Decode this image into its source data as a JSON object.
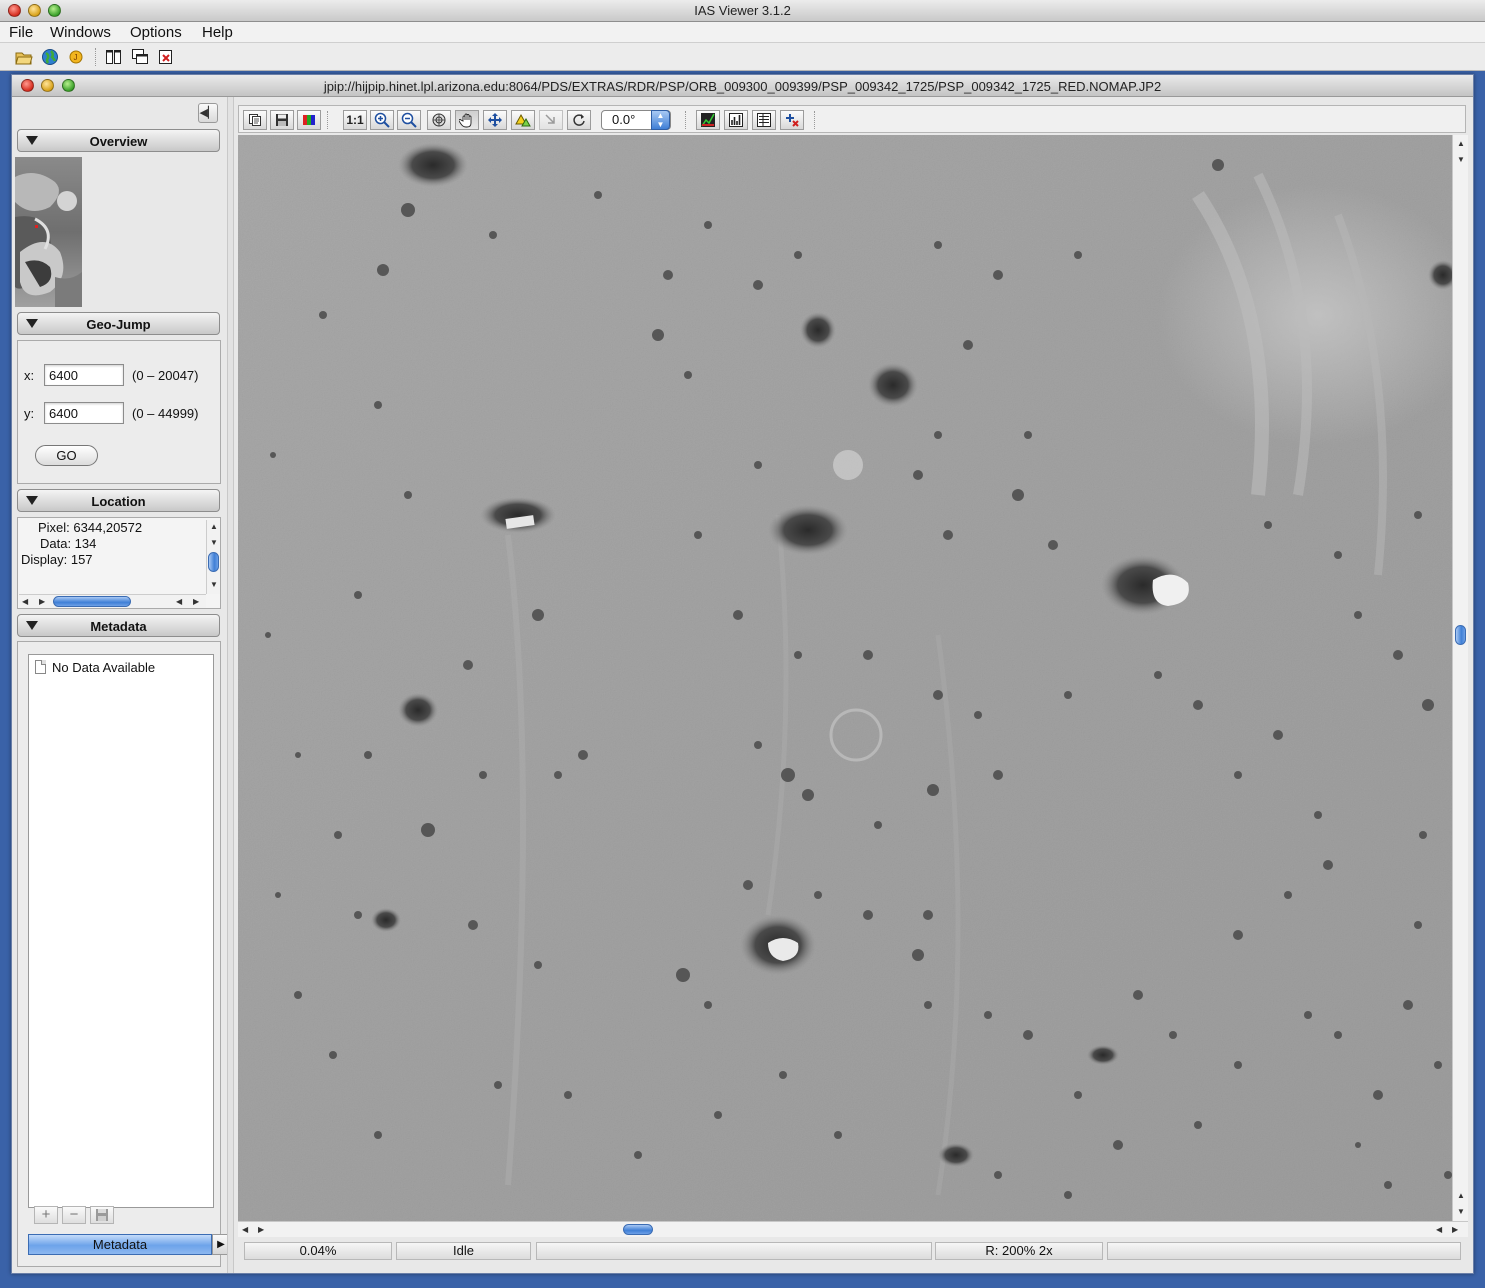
{
  "app": {
    "title": "IAS Viewer 3.1.2",
    "menus": [
      "File",
      "Windows",
      "Options",
      "Help"
    ],
    "toolbar_icons": [
      "open-folder-icon",
      "globe-icon",
      "jpip-icon",
      "tile-windows-icon",
      "cascade-windows-icon",
      "close-windows-icon"
    ]
  },
  "frame": {
    "title": "jpip://hijpip.hinet.lpl.arizona.edu:8064/PDS/EXTRAS/RDR/PSP/ORB_009300_009399/PSP_009342_1725/PSP_009342_1725_RED.NOMAP.JP2"
  },
  "sidebar": {
    "collapse_glyph": "◀▏",
    "overview": {
      "label": "Overview"
    },
    "geojump": {
      "label": "Geo-Jump",
      "x_label": "x:",
      "x_value": "6400",
      "x_range": "(0 – 20047)",
      "y_label": "y:",
      "y_value": "6400",
      "y_range": "(0 – 44999)",
      "go_label": "GO"
    },
    "location": {
      "label": "Location",
      "pixel": "Pixel: 6344,20572",
      "data": "Data: 134",
      "display": "Display: 157"
    },
    "metadata": {
      "label": "Metadata",
      "empty_text": "No Data Available",
      "tab_label": "Metadata",
      "add_glyph": "+",
      "remove_glyph": "−"
    }
  },
  "viewer": {
    "rotation": "0.0°",
    "one_to_one": "1:1",
    "tools": [
      "copy-icon",
      "save-icon",
      "color-bands-icon",
      "actual-size-icon",
      "zoom-in-icon",
      "zoom-out-icon",
      "target-icon",
      "pan-hand-icon",
      "center-icon",
      "warning-triangle-icon",
      "flip-icon",
      "rotate-icon",
      "histogram-icon",
      "bar-chart-icon",
      "properties-icon",
      "crosshair-icon"
    ],
    "status": {
      "progress": "0.04%",
      "state": "Idle",
      "resolution": "R: 200% 2x"
    }
  },
  "colors": {
    "desktop": "#3a62a8",
    "accent_blue": "#3f7fd6",
    "close_red": "#d62d1f",
    "minimize_yellow": "#d8a21a",
    "zoom_green": "#3aa02a"
  }
}
